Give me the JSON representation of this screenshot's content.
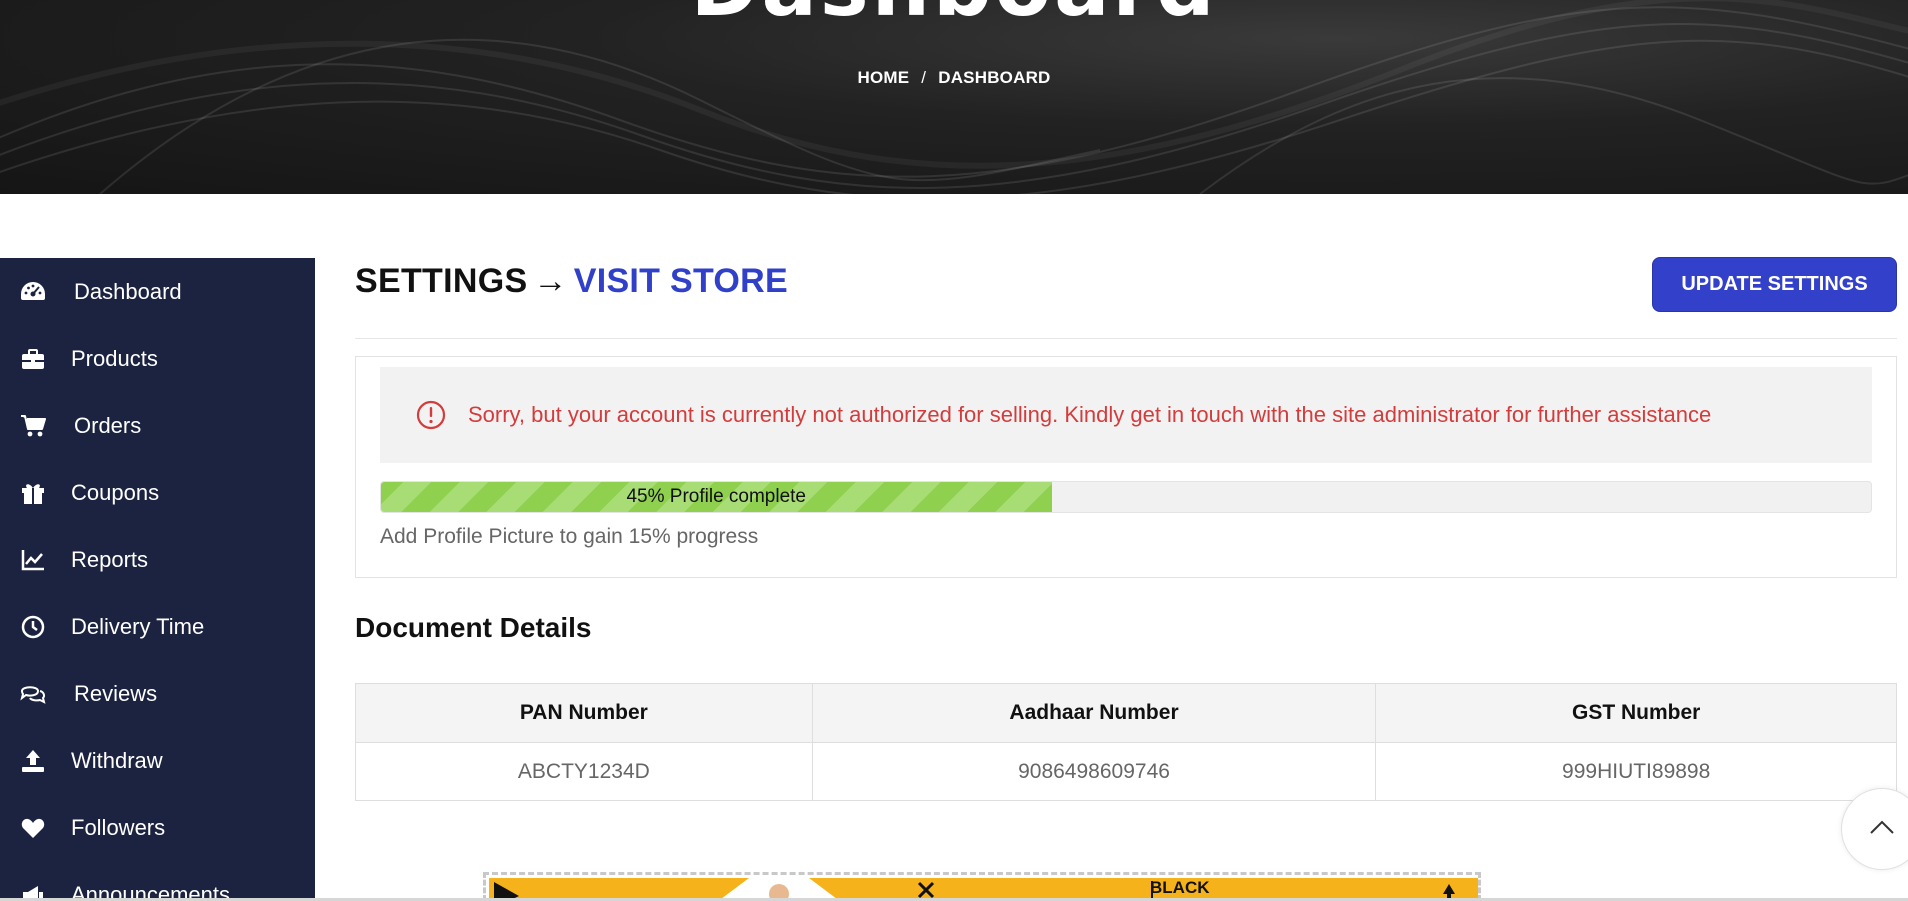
{
  "hero": {
    "title": "Dashboard",
    "breadcrumb": {
      "home": "HOME",
      "separator": "/",
      "current": "DASHBOARD"
    }
  },
  "sidebar": {
    "items": [
      {
        "label": "Dashboard",
        "icon": "dashboard-gauge-icon"
      },
      {
        "label": "Products",
        "icon": "briefcase-icon"
      },
      {
        "label": "Orders",
        "icon": "cart-icon"
      },
      {
        "label": "Coupons",
        "icon": "gift-icon"
      },
      {
        "label": "Reports",
        "icon": "line-chart-icon"
      },
      {
        "label": "Delivery Time",
        "icon": "clock-icon"
      },
      {
        "label": "Reviews",
        "icon": "comments-icon"
      },
      {
        "label": "Withdraw",
        "icon": "upload-icon"
      },
      {
        "label": "Followers",
        "icon": "heart-icon"
      },
      {
        "label": "Announcements",
        "icon": "bullhorn-icon"
      }
    ]
  },
  "header": {
    "settings_label": "SETTINGS",
    "arrow": "→",
    "visit_store_label": "VISIT STORE",
    "update_button_label": "UPDATE SETTINGS"
  },
  "status": {
    "alert_text": "Sorry, but your account is currently not authorized for selling. Kindly get in touch with the site administrator for further assistance",
    "progress_percent": 45,
    "progress_label": "45% Profile complete",
    "progress_hint": "Add Profile Picture to gain 15% progress"
  },
  "documents": {
    "title": "Document Details",
    "headers": [
      "PAN Number",
      "Aadhaar Number",
      "GST Number"
    ],
    "values": [
      "ABCTY1234D",
      "9086498609746",
      "999HIUTI89898"
    ]
  },
  "banner": {
    "text": "BLACK"
  },
  "colors": {
    "sidebar_bg": "#1c2340",
    "accent": "#3340c9",
    "alert_text": "#d33c3c",
    "progress_fill": "#8fd04e",
    "banner_bg": "#f6b21b"
  }
}
